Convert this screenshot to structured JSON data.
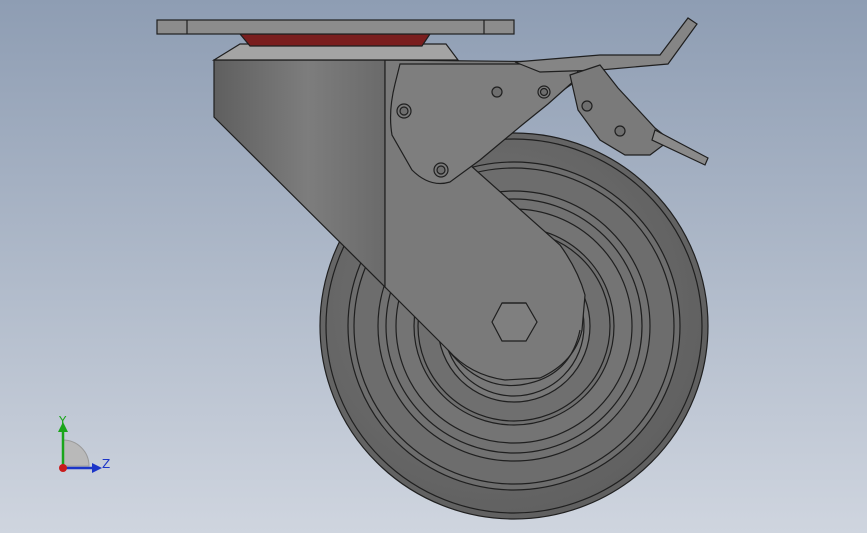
{
  "viewport": {
    "background_top": "#8e9db3",
    "background_bottom": "#cfd5df"
  },
  "model": {
    "part": "swivel-caster-with-brake",
    "colors": {
      "body": "#6f6f6f",
      "body_light": "#8a8a8a",
      "body_dark": "#4e4e4e",
      "edge": "#1f1f1f",
      "bearing": "#7a1e1e",
      "tire": "#6a6a6a"
    }
  },
  "triad": {
    "y_label": "Y",
    "z_label": "Z",
    "y_color": "#1aa51a",
    "z_color": "#1b35c8",
    "x_color": "#c81b1b"
  }
}
